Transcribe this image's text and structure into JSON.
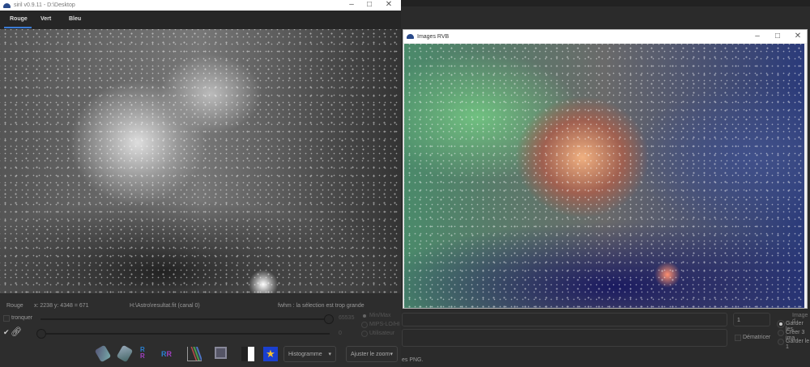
{
  "siril": {
    "title": "siril v0.9.11 - D:\\Desktop",
    "tabs": [
      "Rouge",
      "Vert",
      "Bleu"
    ],
    "status": {
      "channel": "Rouge",
      "coords": "x: 2238 y: 4348 = 671",
      "file": "H:\\Astro\\resultat.fit (canal 0)",
      "fwhm": "fwhm : la sélection est trop grande"
    },
    "clip_label": "tronquer",
    "high_value": "65535",
    "low_value": "0",
    "scale_modes": [
      "Min/Max",
      "MIPS-LO/HI",
      "Utilisateur"
    ],
    "view_select": "Histogramme",
    "zoom_select": "Ajuster le zoom",
    "toolbar_icons": [
      "rotate-left-icon",
      "rotate-right-icon",
      "mirror-x-icon",
      "mirror-y-icon",
      "histogram-icon",
      "image-stack-icon",
      "negative-icon",
      "colormap-icon"
    ]
  },
  "rgb": {
    "title": "Images RVB"
  },
  "background": {
    "field_value": "1",
    "debayer_label": "Dématricer",
    "group_label": "Image d",
    "radios": [
      "Garder les",
      "Créer 3 ima",
      "Garder le 1"
    ],
    "footer": "es PNG."
  }
}
